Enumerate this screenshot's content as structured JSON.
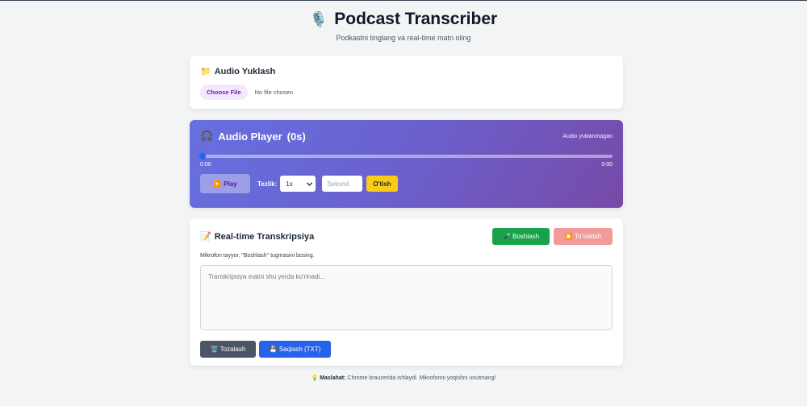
{
  "header": {
    "title": "Podcast Transcriber",
    "title_icon": "🎙️",
    "subtitle": "Podkastni tinglang va real-time matn oling"
  },
  "upload": {
    "icon": "📁",
    "title": "Audio Yuklash",
    "choose_label": "Choose File",
    "no_file_label": "No file chosen"
  },
  "player": {
    "icon": "🎧",
    "title": "Audio Player",
    "duration": "(0s)",
    "status": "Audio yuklanmagan",
    "progress": 0,
    "current_time": "0:00",
    "total_time": "0:00",
    "play_icon": "▶️",
    "play_label": "Play",
    "speed_label": "Tezlik:",
    "speed_value": "1x",
    "seconds_placeholder": "Sekund",
    "jump_label": "O'tish"
  },
  "transcript": {
    "icon": "📝",
    "title": "Real-time Transkripsiya",
    "start_icon": "🎤",
    "start_label": "Boshlash",
    "stop_icon": "⏹️",
    "stop_label": "To'xtatish",
    "status": "Mikrofon tayyor. \"Boshlash\" tugmasini bosing.",
    "placeholder": "Transkripsiya matni shu yerda ko'rinadi...",
    "clear_icon": "🗑️",
    "clear_label": "Tozalash",
    "save_icon": "💾",
    "save_label": "Saqlash (TXT)"
  },
  "tip": {
    "icon": "💡",
    "bold": "Maslahat:",
    "text": "Chrome brauzerida ishlaydi. Mikrofonni yoqishni unutmang!"
  },
  "colors": {
    "accent_start": "#16a34a",
    "accent_stop": "#f19a9a",
    "save": "#2563eb",
    "jump": "#facc15",
    "player_gradient_from": "#6670e0",
    "player_gradient_to": "#774aa8"
  }
}
